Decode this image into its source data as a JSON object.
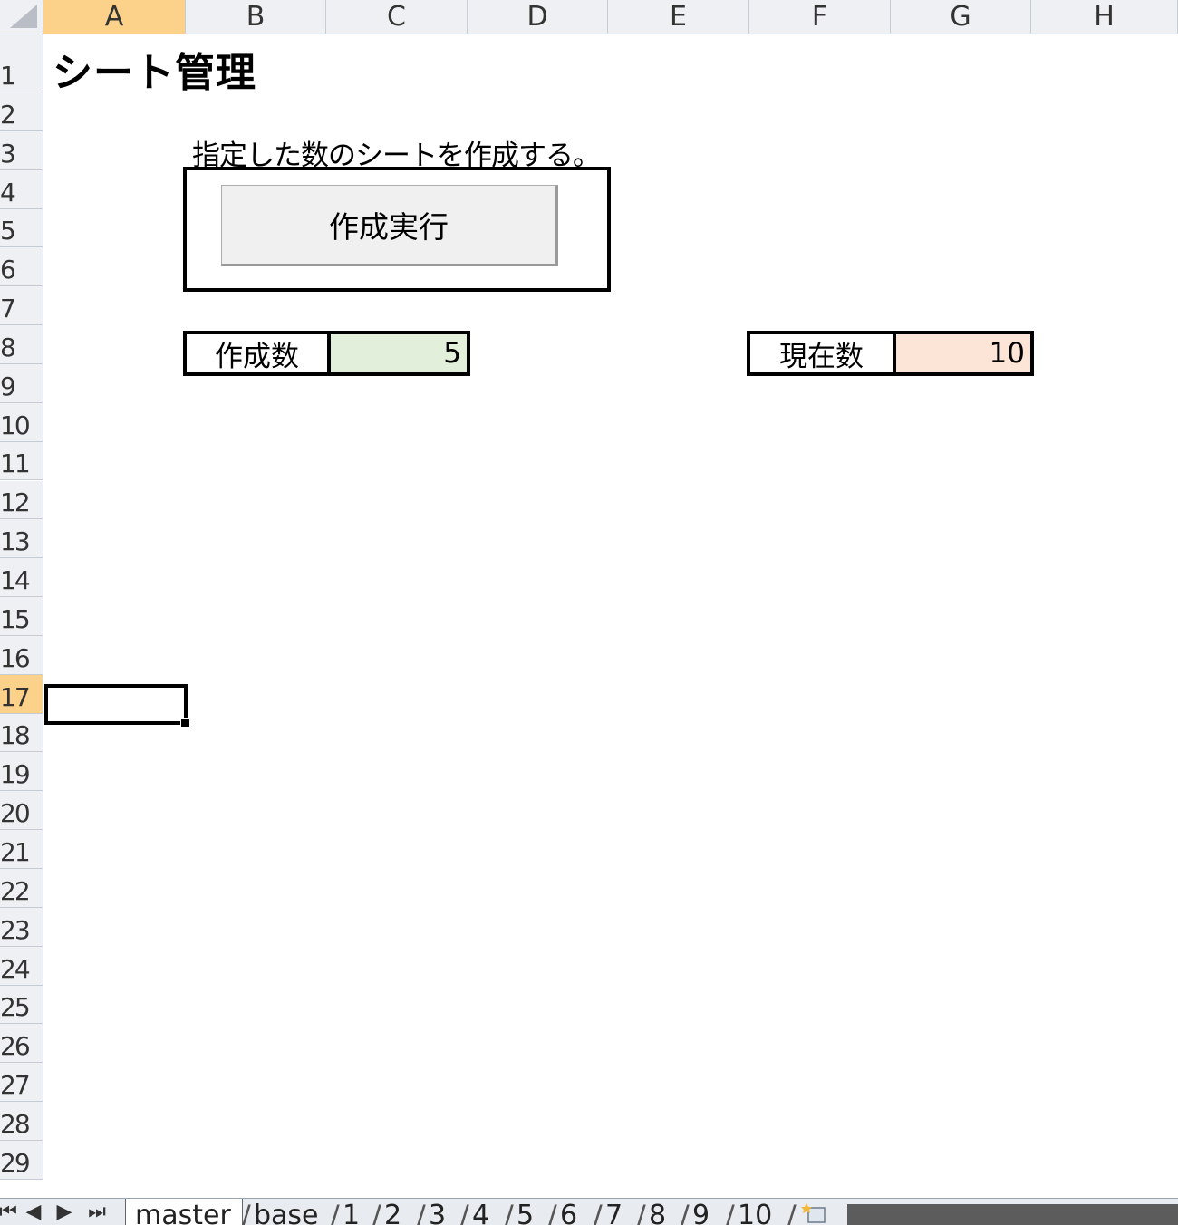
{
  "grid": {
    "columns": [
      "A",
      "B",
      "C",
      "D",
      "E",
      "F",
      "G",
      "H"
    ],
    "selected_column": "A",
    "rows": [
      "1",
      "2",
      "3",
      "4",
      "5",
      "6",
      "7",
      "8",
      "9",
      "10",
      "11",
      "12",
      "13",
      "14",
      "15",
      "16",
      "17",
      "18",
      "19",
      "20",
      "21",
      "22",
      "23",
      "24",
      "25",
      "26",
      "27",
      "28",
      "29"
    ],
    "selected_row": "17"
  },
  "sheet_content": {
    "title": "シート管理",
    "description": "指定した数のシートを作成する。",
    "run_button_label": "作成実行",
    "create_count": {
      "label": "作成数",
      "value": "5",
      "fill": "#e2efda"
    },
    "current_count": {
      "label": "現在数",
      "value": "10",
      "fill": "#fce4d6"
    }
  },
  "tabs": {
    "nav": [
      "⏮",
      "◀",
      "▶",
      "⏭"
    ],
    "sheets": [
      "master",
      "base",
      "1",
      "2",
      "3",
      "4",
      "5",
      "6",
      "7",
      "8",
      "9",
      "10"
    ],
    "active_sheet": "master"
  }
}
